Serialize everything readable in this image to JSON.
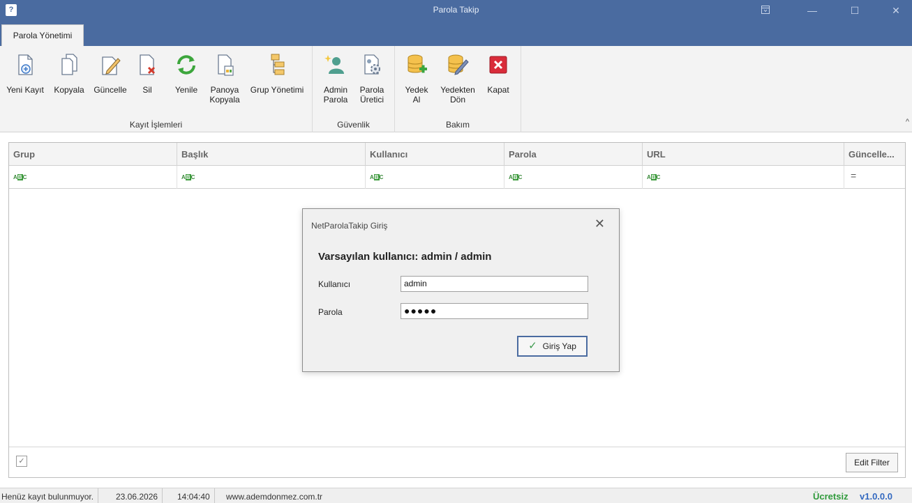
{
  "window": {
    "title": "Parola Takip",
    "app_icon": "?",
    "controls": {
      "ribbon_display_icon": "ribbon-display-options-icon",
      "minimize_glyph": "—",
      "maximize_glyph": "☐",
      "close_glyph": "✕"
    }
  },
  "ribbon": {
    "active_tab": "Parola Yönetimi",
    "collapse_glyph": "^",
    "groups": [
      {
        "label": "Kayıt İşlemleri",
        "buttons": [
          {
            "label": "Yeni Kayıt",
            "icon": "new-record-icon"
          },
          {
            "label": "Kopyala",
            "icon": "copy-icon"
          },
          {
            "label": "Güncelle",
            "icon": "edit-icon"
          },
          {
            "label": "Sil",
            "icon": "delete-icon"
          },
          {
            "label": "Yenile",
            "icon": "refresh-icon"
          },
          {
            "label": "Panoya\nKopyala",
            "icon": "clipboard-copy-icon"
          },
          {
            "label": "Grup Yönetimi",
            "icon": "group-tree-icon"
          }
        ]
      },
      {
        "label": "Güvenlik",
        "buttons": [
          {
            "label": "Admin\nParola",
            "icon": "admin-user-icon"
          },
          {
            "label": "Parola\nÜretici",
            "icon": "password-generator-icon"
          }
        ]
      },
      {
        "label": "Bakım",
        "buttons": [
          {
            "label": "Yedek\nAl",
            "icon": "backup-icon"
          },
          {
            "label": "Yedekten\nDön",
            "icon": "restore-icon"
          },
          {
            "label": "Kapat",
            "icon": "close-app-icon"
          }
        ]
      }
    ]
  },
  "grid": {
    "columns": [
      "Grup",
      "Başlık",
      "Kullanıcı",
      "Parola",
      "URL",
      "Güncelle..."
    ],
    "filter_icon_text": {
      "a": "A",
      "b": "B",
      "c": "C"
    },
    "equals_glyph": "=",
    "footer": {
      "check_glyph": "✓",
      "edit_filter_label": "Edit Filter"
    }
  },
  "dialog": {
    "title": "NetParolaTakip Giriş",
    "close_glyph": "✕",
    "heading": "Varsayılan kullanıcı: admin / admin",
    "user_label": "Kullanıcı",
    "user_value": "admin",
    "password_label": "Parola",
    "password_value": "●●●●●",
    "login_check": "✓",
    "login_label": "Giriş Yap"
  },
  "statusbar": {
    "message": "Henüz kayıt bulunmuyor.",
    "date": "23.06.2026",
    "time": "14:04:40",
    "website": "www.ademdonmez.com.tr",
    "license": "Ücretsiz",
    "version": "v1.0.0.0"
  },
  "colors": {
    "titlebar": "#4a6ba0",
    "ribbon_bg": "#f3f3f3",
    "license_green": "#2f9a3b",
    "version_blue": "#3369c0"
  }
}
